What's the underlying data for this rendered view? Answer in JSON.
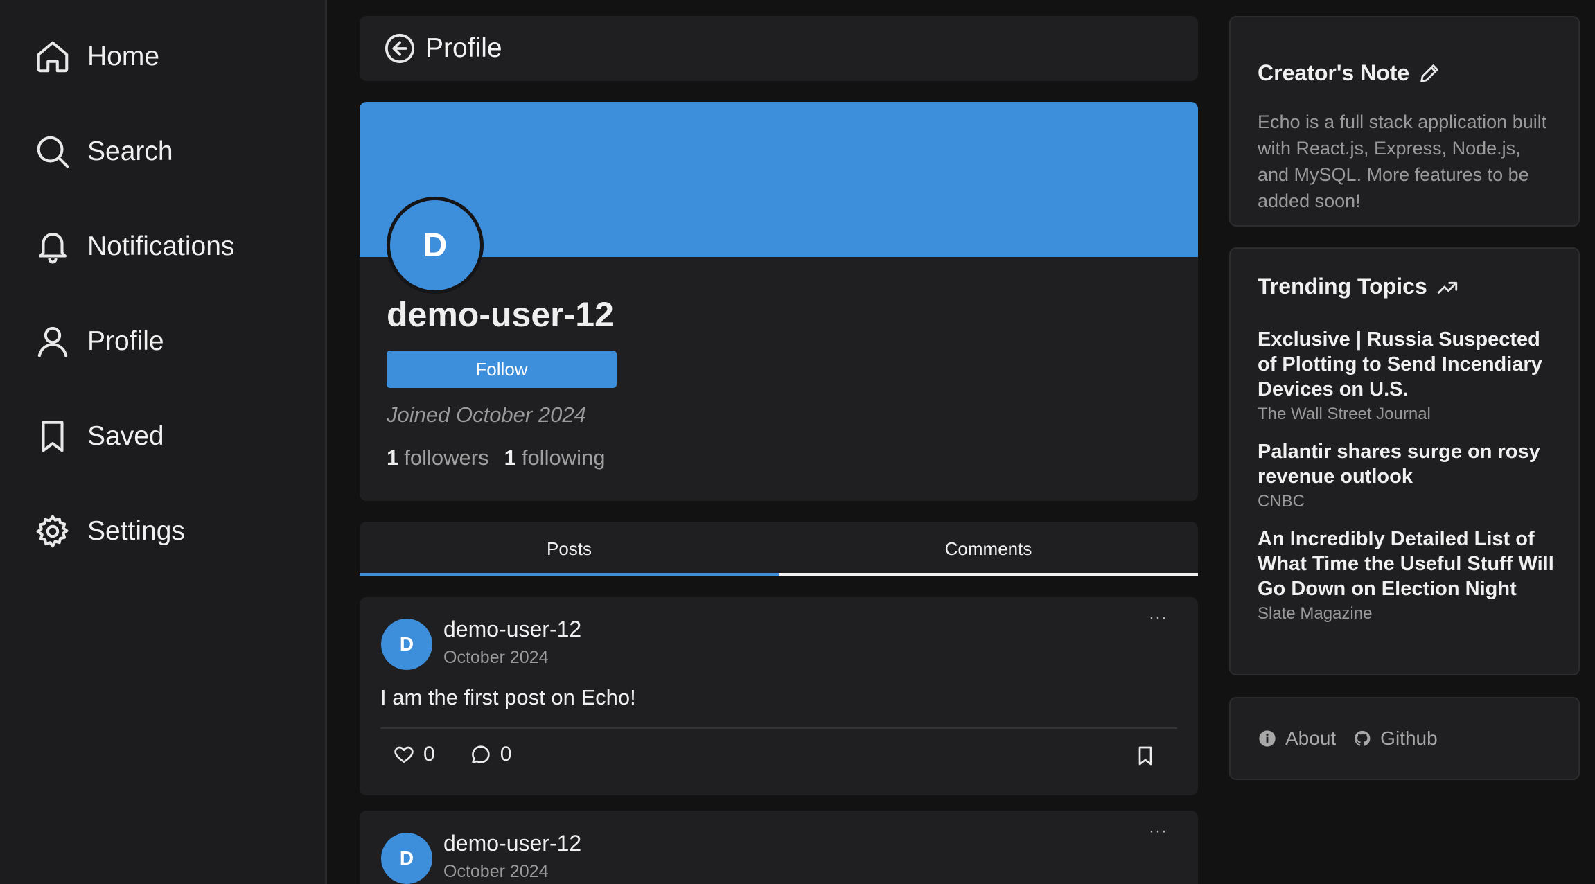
{
  "sidebar": {
    "items": [
      {
        "label": "Home",
        "icon": "home-icon"
      },
      {
        "label": "Search",
        "icon": "search-icon"
      },
      {
        "label": "Notifications",
        "icon": "bell-icon"
      },
      {
        "label": "Profile",
        "icon": "user-icon"
      },
      {
        "label": "Saved",
        "icon": "bookmark-icon"
      },
      {
        "label": "Settings",
        "icon": "gear-icon"
      }
    ]
  },
  "header": {
    "title": "Profile",
    "back_icon": "arrow-left-circle-icon"
  },
  "profile": {
    "avatar_initial": "D",
    "username": "demo-user-12",
    "follow_label": "Follow",
    "joined": "Joined October 2024",
    "followers_count": "1",
    "followers_label": "followers",
    "following_count": "1",
    "following_label": "following",
    "banner_color": "#3d8edb"
  },
  "tabs": [
    {
      "label": "Posts",
      "active": true
    },
    {
      "label": "Comments",
      "active": false
    }
  ],
  "posts": [
    {
      "avatar_initial": "D",
      "author": "demo-user-12",
      "date": "October 2024",
      "more": "···",
      "text": "I am the first post on Echo!",
      "likes": "0",
      "comments": "0"
    },
    {
      "avatar_initial": "D",
      "author": "demo-user-12",
      "date": "October 2024",
      "more": "···"
    }
  ],
  "creator_note": {
    "title": "Creator's Note",
    "icon": "pencil-icon",
    "text": "Echo is a full stack application built with React.js, Express, Node.js, and MySQL. More features to be added soon!"
  },
  "trending": {
    "title": "Trending Topics",
    "icon": "trending-up-icon",
    "items": [
      {
        "headline": "Exclusive | Russia Suspected of Plotting to Send Incendiary Devices on U.S.",
        "source": "The Wall Street Journal"
      },
      {
        "headline": "Palantir shares surge on rosy revenue outlook",
        "source": "CNBC"
      },
      {
        "headline": "An Incredibly Detailed List of What Time the Useful Stuff Will Go Down on Election Night",
        "source": "Slate Magazine"
      }
    ]
  },
  "footer": {
    "about_label": "About",
    "github_label": "Github"
  },
  "colors": {
    "accent": "#3d8edb",
    "background": "#121212",
    "card": "#1f1f21"
  }
}
